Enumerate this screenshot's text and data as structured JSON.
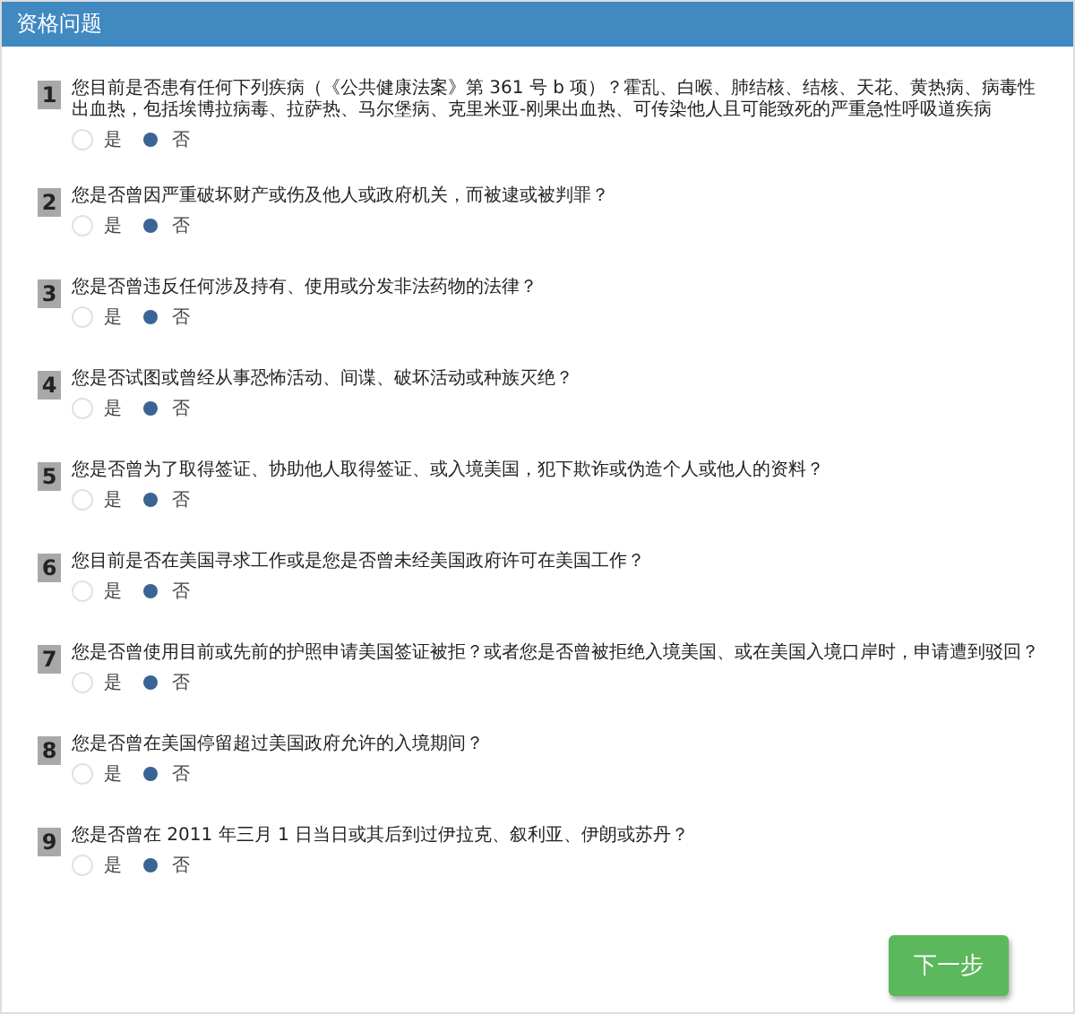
{
  "header": {
    "title": "资格问题"
  },
  "questions": [
    {
      "number": "1",
      "text": "您目前是否患有任何下列疾病（《公共健康法案》第 361 号 b 项）？霍乱、白喉、肺结核、结核、天花、黄热病、病毒性出血热，包括埃博拉病毒、拉萨热、马尔堡病、克里米亚-刚果出血热、可传染他人且可能致死的严重急性呼吸道疾病",
      "options": [
        {
          "label": "是",
          "selected": false
        },
        {
          "label": "否",
          "selected": true
        }
      ]
    },
    {
      "number": "2",
      "text": "您是否曾因严重破坏财产或伤及他人或政府机关，而被逮或被判罪？",
      "options": [
        {
          "label": "是",
          "selected": false
        },
        {
          "label": "否",
          "selected": true
        }
      ]
    },
    {
      "number": "3",
      "text": "您是否曾违反任何涉及持有、使用或分发非法药物的法律？",
      "options": [
        {
          "label": "是",
          "selected": false
        },
        {
          "label": "否",
          "selected": true
        }
      ]
    },
    {
      "number": "4",
      "text": "您是否试图或曾经从事恐怖活动、间谍、破坏活动或种族灭绝？",
      "options": [
        {
          "label": "是",
          "selected": false
        },
        {
          "label": "否",
          "selected": true
        }
      ]
    },
    {
      "number": "5",
      "text": "您是否曾为了取得签证、协助他人取得签证、或入境美国，犯下欺诈或伪造个人或他人的资料？",
      "options": [
        {
          "label": "是",
          "selected": false
        },
        {
          "label": "否",
          "selected": true
        }
      ]
    },
    {
      "number": "6",
      "text": "您目前是否在美国寻求工作或是您是否曾未经美国政府许可在美国工作？",
      "options": [
        {
          "label": "是",
          "selected": false
        },
        {
          "label": "否",
          "selected": true
        }
      ]
    },
    {
      "number": "7",
      "text": "您是否曾使用目前或先前的护照申请美国签证被拒？或者您是否曾被拒绝入境美国、或在美国入境口岸时，申请遭到驳回？",
      "options": [
        {
          "label": "是",
          "selected": false
        },
        {
          "label": "否",
          "selected": true
        }
      ]
    },
    {
      "number": "8",
      "text": "您是否曾在美国停留超过美国政府允许的入境期间？",
      "options": [
        {
          "label": "是",
          "selected": false
        },
        {
          "label": "否",
          "selected": true
        }
      ]
    },
    {
      "number": "9",
      "text": "您是否曾在 2011 年三月 1 日当日或其后到过伊拉克、叙利亚、伊朗或苏丹？",
      "options": [
        {
          "label": "是",
          "selected": false
        },
        {
          "label": "否",
          "selected": true
        }
      ]
    }
  ],
  "next_button": {
    "label": "下一步"
  }
}
